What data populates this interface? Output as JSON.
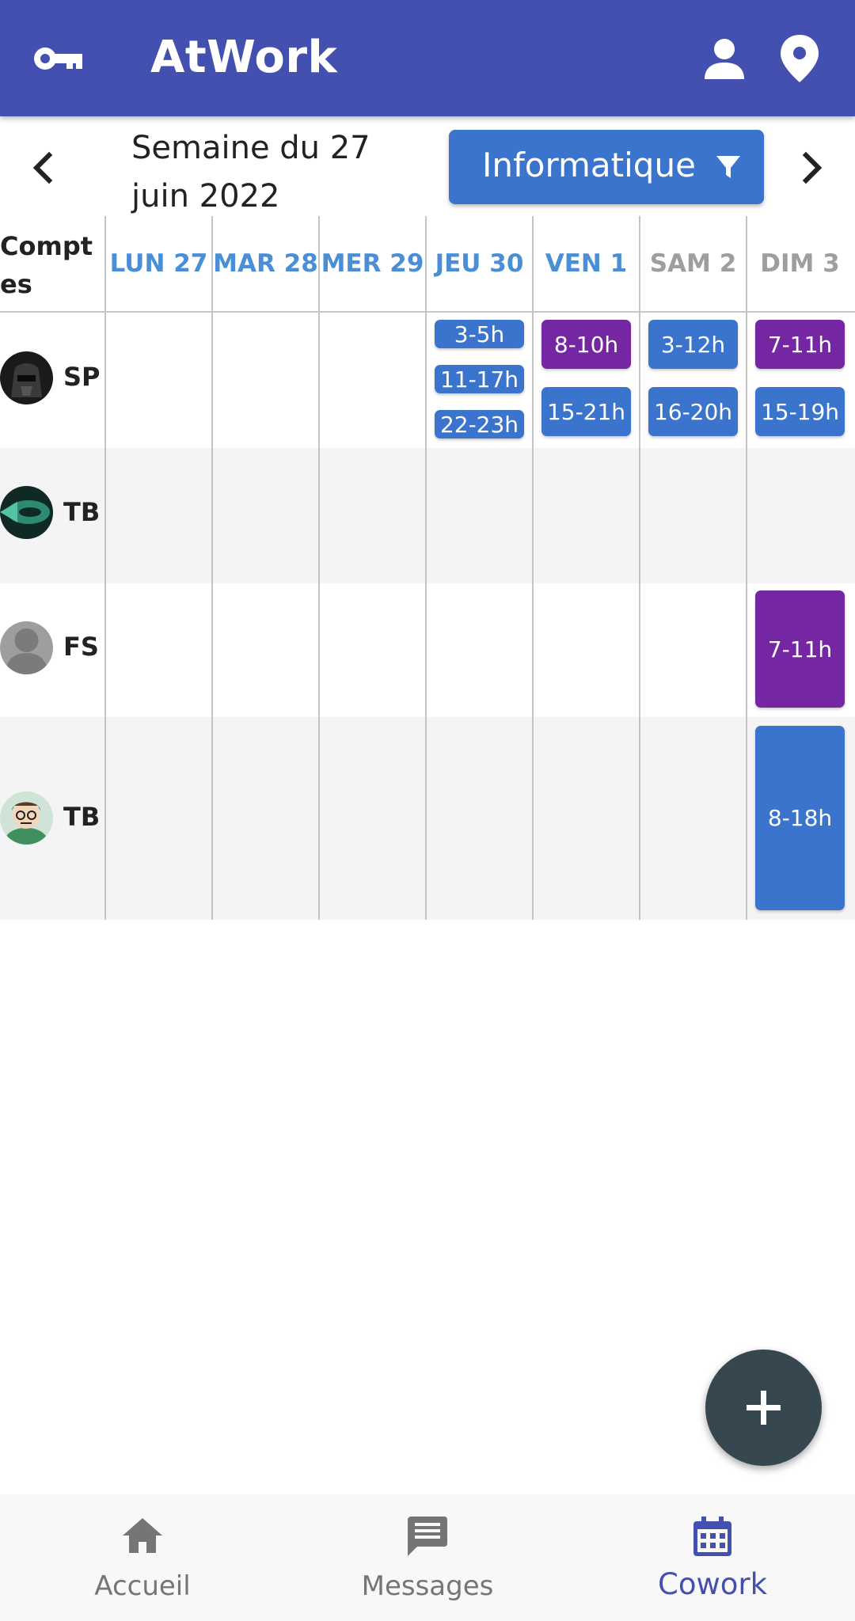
{
  "appbar": {
    "title": "AtWork",
    "left_icon": "key-icon",
    "right_icons": [
      "person-icon",
      "location-pin-icon"
    ],
    "color": "#4450b0"
  },
  "weeknav": {
    "week_label": "Semaine du 27 juin 2022",
    "filter_label": "Informatique",
    "filter_icon": "filter-icon"
  },
  "grid": {
    "accounts_header": "Comptes",
    "days": [
      {
        "label": "LUN 27",
        "weekend": false
      },
      {
        "label": "MAR 28",
        "weekend": false
      },
      {
        "label": "MER 29",
        "weekend": false
      },
      {
        "label": "JEU 30",
        "weekend": false
      },
      {
        "label": "VEN 1",
        "weekend": false
      },
      {
        "label": "SAM 2",
        "weekend": true
      },
      {
        "label": "DIM 3",
        "weekend": true
      }
    ],
    "rows": [
      {
        "initials": "SP",
        "avatar": "dark-helmet-avatar",
        "shifts": [
          {
            "day": 3,
            "label": "3-5h",
            "color": "blue"
          },
          {
            "day": 3,
            "label": "11-17h",
            "color": "blue"
          },
          {
            "day": 3,
            "label": "22-23h",
            "color": "blue"
          },
          {
            "day": 4,
            "label": "8-10h",
            "color": "purple"
          },
          {
            "day": 4,
            "label": "15-21h",
            "color": "blue"
          },
          {
            "day": 5,
            "label": "3-12h",
            "color": "blue"
          },
          {
            "day": 5,
            "label": "16-20h",
            "color": "blue"
          },
          {
            "day": 6,
            "label": "7-11h",
            "color": "purple"
          },
          {
            "day": 6,
            "label": "15-19h",
            "color": "blue"
          }
        ]
      },
      {
        "initials": "TB",
        "avatar": "green-fish-avatar",
        "shifts": []
      },
      {
        "initials": "FS",
        "avatar": "default-person-avatar",
        "shifts": [
          {
            "day": 6,
            "label": "7-11h",
            "color": "purple"
          }
        ]
      },
      {
        "initials": "TB",
        "avatar": "cartoon-face-avatar",
        "shifts": [
          {
            "day": 6,
            "label": "8-18h",
            "color": "blue"
          }
        ]
      }
    ]
  },
  "colors": {
    "blue": "#3a74cd",
    "purple": "#7526a2",
    "weekday_header": "#4a8fd6",
    "weekend_header": "#9e9e9e"
  },
  "fab": {
    "icon": "plus-icon"
  },
  "bottomnav": [
    {
      "label": "Accueil",
      "icon": "home-icon",
      "active": false
    },
    {
      "label": "Messages",
      "icon": "message-icon",
      "active": false
    },
    {
      "label": "Cowork",
      "icon": "calendar-icon",
      "active": true
    }
  ]
}
